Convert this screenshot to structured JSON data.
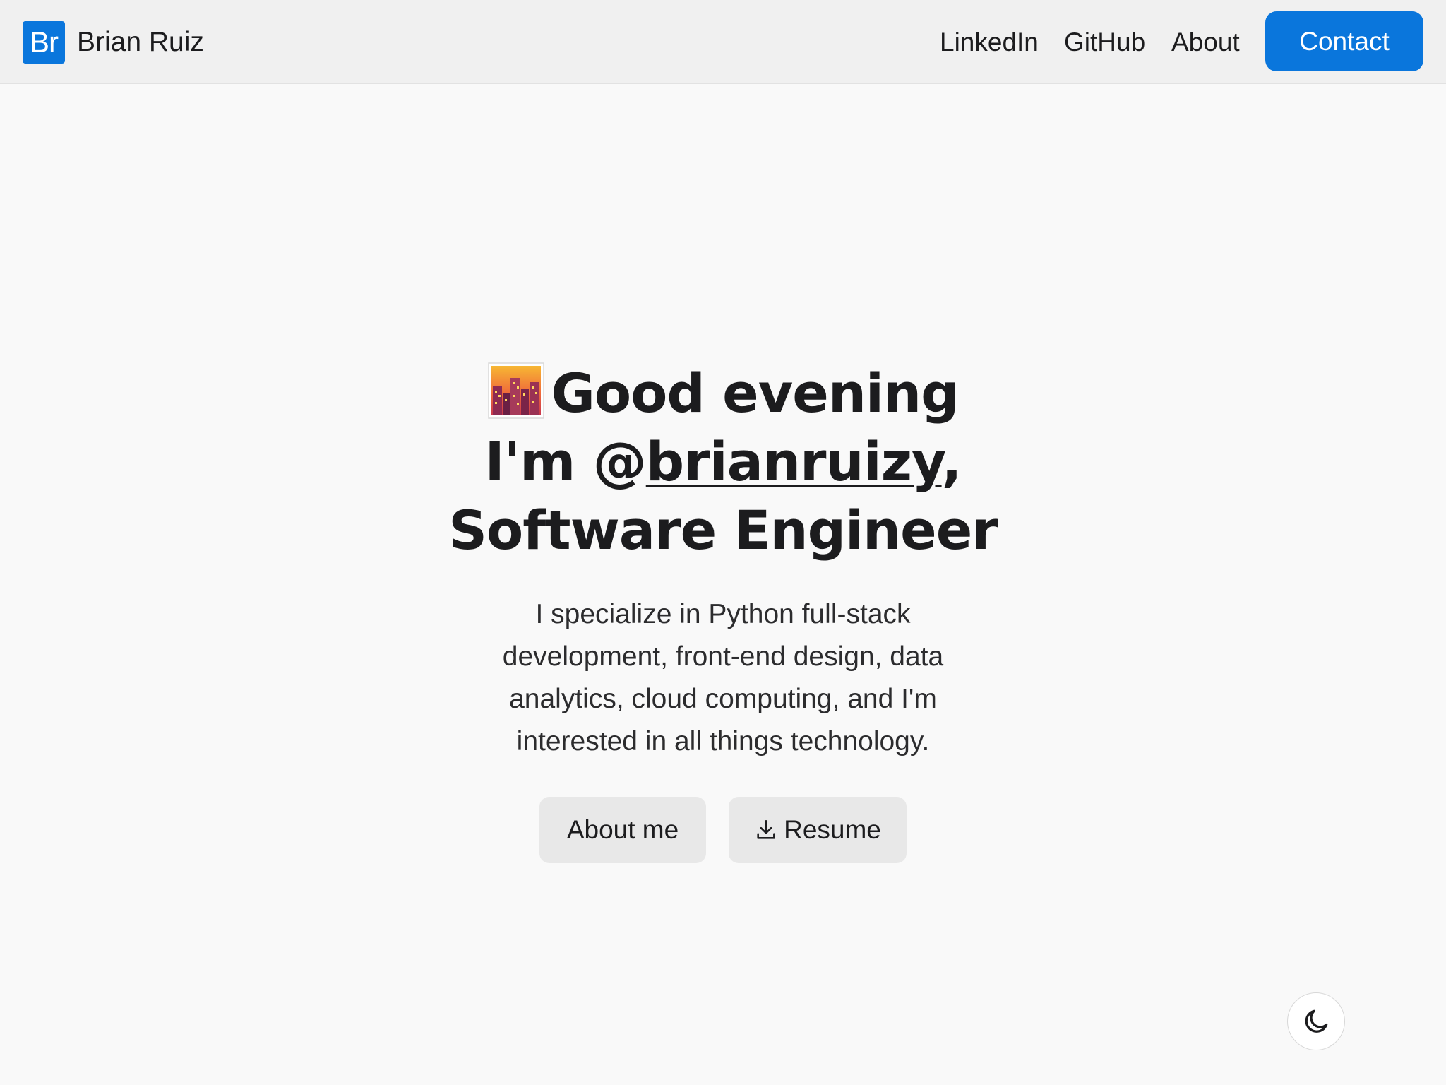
{
  "header": {
    "logo_text": "Br",
    "brand_name": "Brian Ruiz",
    "nav": {
      "linkedin": "LinkedIn",
      "github": "GitHub",
      "about": "About",
      "contact": "Contact"
    }
  },
  "hero": {
    "greeting_icon": "cityscape-at-dusk-emoji",
    "greeting": "Good evening",
    "intro_prefix": "I'm ",
    "handle_at": "@",
    "handle_name": "brianruizy",
    "intro_suffix": ",",
    "role": "Software Engineer",
    "description": "I specialize in Python full-stack development, front-end design, data analytics, cloud computing, and I'm interested in all things technology."
  },
  "actions": {
    "about_me": "About me",
    "resume": "Resume",
    "resume_icon": "download-icon"
  },
  "theme_toggle": {
    "icon": "moon-icon"
  },
  "colors": {
    "accent": "#0a76dc",
    "background": "#f9f9f9",
    "header_bg": "#f0f0f0",
    "button_bg": "#e8e8e8",
    "text": "#1c1c1e"
  }
}
